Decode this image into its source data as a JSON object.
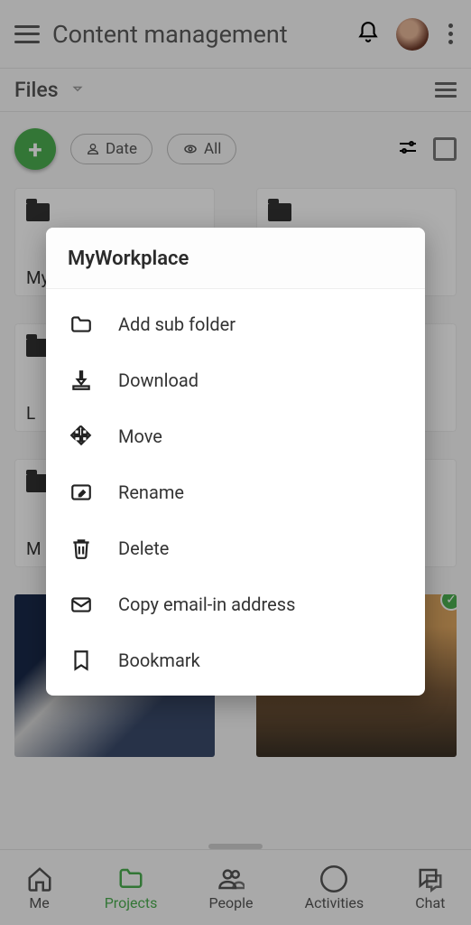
{
  "header": {
    "title": "Content management"
  },
  "subheader": {
    "title": "Files"
  },
  "chips": {
    "date": "Date",
    "all": "All"
  },
  "folders": [
    {
      "name": "MyWorkplace"
    },
    {
      "name": " "
    },
    {
      "name": "L"
    },
    {
      "name": " "
    },
    {
      "name": "M"
    },
    {
      "name": " "
    }
  ],
  "modal": {
    "title": "MyWorkplace",
    "items": {
      "add_sub_folder": "Add sub folder",
      "download": "Download",
      "move": "Move",
      "rename": "Rename",
      "delete": "Delete",
      "copy_email": "Copy email-in address",
      "bookmark": "Bookmark"
    }
  },
  "nav": {
    "me": "Me",
    "projects": "Projects",
    "people": "People",
    "activities": "Activities",
    "chat": "Chat"
  }
}
